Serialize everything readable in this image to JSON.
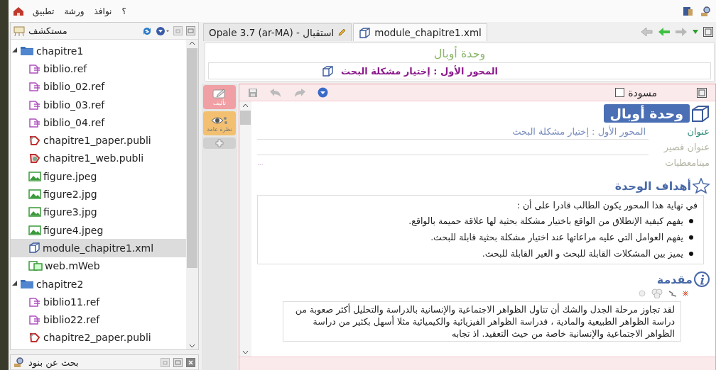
{
  "menu_bar": {
    "items": [
      "؟",
      "نوافذ",
      "ورشة",
      "تطبيق"
    ]
  },
  "explorer": {
    "title": "مستكشف",
    "tree": [
      {
        "label": "chapitre1",
        "kind": "folder",
        "expanded": true,
        "selected": false,
        "children": [
          {
            "label": "biblio.ref",
            "kind": "ref",
            "selected": false
          },
          {
            "label": "biblio_02.ref",
            "kind": "ref",
            "selected": false
          },
          {
            "label": "biblio_03.ref",
            "kind": "ref",
            "selected": false
          },
          {
            "label": "biblio_04.ref",
            "kind": "ref",
            "selected": false
          },
          {
            "label": "chapitre1_paper.publi",
            "kind": "paper",
            "selected": false
          },
          {
            "label": "chapitre1_web.publi",
            "kind": "webpubli",
            "selected": false
          },
          {
            "label": "figure.jpeg",
            "kind": "image",
            "selected": false
          },
          {
            "label": "figure2.jpg",
            "kind": "image",
            "selected": false
          },
          {
            "label": "figure3.jpg",
            "kind": "image",
            "selected": false
          },
          {
            "label": "figure4.jpeg",
            "kind": "image",
            "selected": false
          },
          {
            "label": "module_chapitre1.xml",
            "kind": "module",
            "selected": true
          },
          {
            "label": "web.mWeb",
            "kind": "web",
            "selected": false
          }
        ]
      },
      {
        "label": "chapitre2",
        "kind": "folder",
        "expanded": true,
        "selected": false,
        "children": [
          {
            "label": "biblio11.ref",
            "kind": "ref",
            "selected": false
          },
          {
            "label": "biblio22.ref",
            "kind": "ref",
            "selected": false
          },
          {
            "label": "chapitre2_paper.publi",
            "kind": "paper",
            "selected": false
          }
        ]
      }
    ]
  },
  "search_panel": {
    "title": "بحث عن بنود"
  },
  "editor_tabs": [
    {
      "label": "module_chapitre1.xml",
      "kind": "module",
      "selected": true
    },
    {
      "label": "Opale 3.7 (ar-MA) - استقبال",
      "kind": "home",
      "selected": false
    }
  ],
  "document_header": {
    "title": "وحدة أوبال",
    "breadcrumb": "المحور الأول : إختيار مشكلة البحث"
  },
  "modes": [
    {
      "label": "تأليف",
      "kind": "author",
      "selected": true
    },
    {
      "label": "نظرة عامة",
      "kind": "overview",
      "selected": false
    }
  ],
  "draft": {
    "label": "مسودة",
    "checked": false
  },
  "unit": {
    "title": "وحدة أوبال",
    "fields": [
      {
        "label": "عنوان",
        "filled": true,
        "value": "المحور الأول : إختيار مشكلة البحث"
      },
      {
        "label": "عنوان قصير",
        "filled": false
      },
      {
        "label": "ميتامعطيات",
        "filled": false,
        "value": "..."
      }
    ]
  },
  "sections": [
    {
      "kind": "objectives",
      "title": "أهداف الوحدة",
      "intro": "في نهاية هذا المحور يكون الطالب قادرا على أن :",
      "bullets": [
        "يفهم كيفية الإنطلاق من الواقع باختيار مشكلة بحثية لها علاقة حميمة بالواقع.",
        "يفهم العوامل التي عليه مراعاتها عند اختيار مشكلة بحثية قابلة للبحث.",
        "يميز بين المشكلات القابلة للبحث و الغير القابلة للبحث."
      ]
    },
    {
      "kind": "introduction",
      "title": "مقدمة",
      "text": "لقد تجاوز مرحلة الجدل والشك أن تناول الظواهر الاجتماعية والإنسانية بالدراسة والتحليل أكثر صعوبة من دراسة الظواهر الطبيعية والمادية ، فدراسة الظواهر الفيزيائية والكيميائية مثلا أسهل بكثير من دراسة الظواهر الاجتماعية والإنسانية خاصة من حيث التعقيد. اذ تجابه"
    }
  ]
}
